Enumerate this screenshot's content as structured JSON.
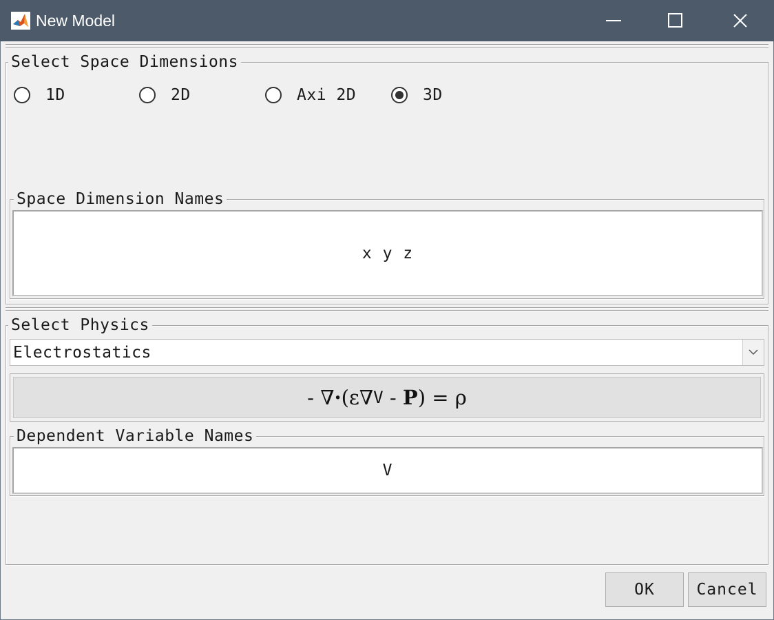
{
  "window": {
    "title": "New Model",
    "icons": {
      "app": "matlab-icon",
      "minimize": "minimize-icon",
      "maximize": "maximize-icon",
      "close": "close-icon"
    }
  },
  "space_dimensions": {
    "group_label": "Select Space Dimensions",
    "options": [
      {
        "label": "1D",
        "checked": false
      },
      {
        "label": "2D",
        "checked": false
      },
      {
        "label": "Axi 2D",
        "checked": false
      },
      {
        "label": "3D",
        "checked": true
      }
    ],
    "names_label": "Space Dimension Names",
    "names_value": "x y z"
  },
  "physics": {
    "group_label": "Select Physics",
    "selected": "Electrostatics",
    "equation": {
      "minus": "-",
      "nabla1": "∇",
      "dot": "·",
      "open": "(",
      "eps": "ε",
      "nabla2": "∇",
      "var": "V",
      "minus2": "-",
      "P": "P",
      "close": ")",
      "equals": "=",
      "rho": "ρ"
    },
    "dep_label": "Dependent Variable Names",
    "dep_value": "V"
  },
  "buttons": {
    "ok": "OK",
    "cancel": "Cancel"
  },
  "colors": {
    "titlebar": "#4c5a6a",
    "background": "#f0f0f0",
    "button": "#e1e1e1"
  }
}
